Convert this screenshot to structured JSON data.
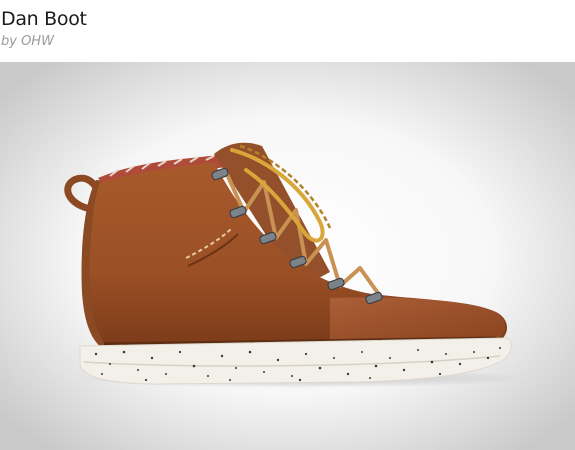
{
  "product": {
    "title": "Dan Boot",
    "byline": "by OHW"
  },
  "image": {
    "subject": "boot",
    "colors": {
      "leather": "#9c5027",
      "sole": "#f3f0ea",
      "laces": "#c99154",
      "background_center": "#ffffff",
      "background_edge": "#cfcfcf"
    }
  }
}
